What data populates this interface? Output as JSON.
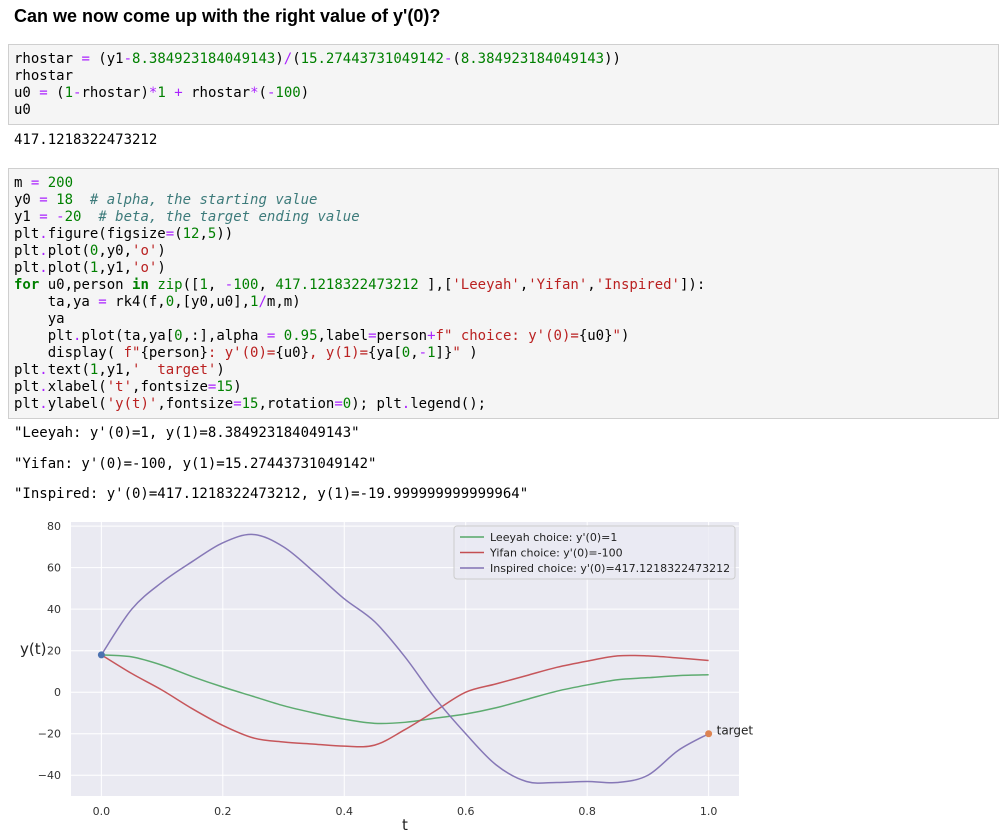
{
  "heading": "Can we now come up with the right value of y'(0)?",
  "cell1": {
    "lines": [
      [
        [
          "n",
          "rhostar "
        ],
        [
          "o",
          "="
        ],
        [
          "n",
          " (y1"
        ],
        [
          "o",
          "-"
        ],
        [
          "m",
          "8.384923184049143"
        ],
        [
          "n",
          ")"
        ],
        [
          "o",
          "/"
        ],
        [
          "n",
          "("
        ],
        [
          "m",
          "15.27443731049142"
        ],
        [
          "o",
          "-"
        ],
        [
          "n",
          "("
        ],
        [
          "m",
          "8.384923184049143"
        ],
        [
          "n",
          "))"
        ]
      ],
      [
        [
          "n",
          "rhostar"
        ]
      ],
      [
        [
          "n",
          "u0 "
        ],
        [
          "o",
          "="
        ],
        [
          "n",
          " ("
        ],
        [
          "m",
          "1"
        ],
        [
          "o",
          "-"
        ],
        [
          "n",
          "rhostar)"
        ],
        [
          "o",
          "*"
        ],
        [
          "m",
          "1"
        ],
        [
          "n",
          " "
        ],
        [
          "o",
          "+"
        ],
        [
          "n",
          " rhostar"
        ],
        [
          "o",
          "*"
        ],
        [
          "n",
          "("
        ],
        [
          "o",
          "-"
        ],
        [
          "m",
          "100"
        ],
        [
          "n",
          ")"
        ]
      ],
      [
        [
          "n",
          "u0"
        ]
      ]
    ]
  },
  "output1": "417.1218322473212",
  "cell2": {
    "lines": [
      [
        [
          "n",
          "m "
        ],
        [
          "o",
          "="
        ],
        [
          "n",
          " "
        ],
        [
          "m",
          "200"
        ]
      ],
      [
        [
          "n",
          "y0 "
        ],
        [
          "o",
          "="
        ],
        [
          "n",
          " "
        ],
        [
          "m",
          "18"
        ],
        [
          "n",
          "  "
        ],
        [
          "c",
          "# alpha, the starting value"
        ]
      ],
      [
        [
          "n",
          "y1 "
        ],
        [
          "o",
          "="
        ],
        [
          "n",
          " "
        ],
        [
          "o",
          "-"
        ],
        [
          "m",
          "20"
        ],
        [
          "n",
          "  "
        ],
        [
          "c",
          "# beta, the target ending value"
        ]
      ],
      [
        [
          "n",
          "plt"
        ],
        [
          "o",
          "."
        ],
        [
          "n",
          "figure(figsize"
        ],
        [
          "o",
          "="
        ],
        [
          "n",
          "("
        ],
        [
          "m",
          "12"
        ],
        [
          "n",
          ","
        ],
        [
          "m",
          "5"
        ],
        [
          "n",
          "))"
        ]
      ],
      [
        [
          "n",
          "plt"
        ],
        [
          "o",
          "."
        ],
        [
          "n",
          "plot("
        ],
        [
          "m",
          "0"
        ],
        [
          "n",
          ",y0,"
        ],
        [
          "s",
          "'o'"
        ],
        [
          "n",
          ")"
        ]
      ],
      [
        [
          "n",
          "plt"
        ],
        [
          "o",
          "."
        ],
        [
          "n",
          "plot("
        ],
        [
          "m",
          "1"
        ],
        [
          "n",
          ",y1,"
        ],
        [
          "s",
          "'o'"
        ],
        [
          "n",
          ")"
        ]
      ],
      [
        [
          "k",
          "for"
        ],
        [
          "n",
          " u0,person "
        ],
        [
          "k",
          "in"
        ],
        [
          "n",
          " "
        ],
        [
          "b",
          "zip"
        ],
        [
          "n",
          "(["
        ],
        [
          "m",
          "1"
        ],
        [
          "n",
          ", "
        ],
        [
          "o",
          "-"
        ],
        [
          "m",
          "100"
        ],
        [
          "n",
          ", "
        ],
        [
          "m",
          "417.1218322473212"
        ],
        [
          "n",
          " ],["
        ],
        [
          "s",
          "'Leeyah'"
        ],
        [
          "n",
          ","
        ],
        [
          "s",
          "'Yifan'"
        ],
        [
          "n",
          ","
        ],
        [
          "s",
          "'Inspired'"
        ],
        [
          "n",
          "]):"
        ]
      ],
      [
        [
          "n",
          "    ta,ya "
        ],
        [
          "o",
          "="
        ],
        [
          "n",
          " rk4(f,"
        ],
        [
          "m",
          "0"
        ],
        [
          "n",
          ",[y0,u0],"
        ],
        [
          "m",
          "1"
        ],
        [
          "o",
          "/"
        ],
        [
          "n",
          "m,m)"
        ]
      ],
      [
        [
          "n",
          "    ya"
        ]
      ],
      [
        [
          "n",
          "    plt"
        ],
        [
          "o",
          "."
        ],
        [
          "n",
          "plot(ta,ya["
        ],
        [
          "m",
          "0"
        ],
        [
          "n",
          ",:],alpha "
        ],
        [
          "o",
          "="
        ],
        [
          "n",
          " "
        ],
        [
          "m",
          "0.95"
        ],
        [
          "n",
          ",label"
        ],
        [
          "o",
          "="
        ],
        [
          "n",
          "person"
        ],
        [
          "o",
          "+"
        ],
        [
          "s",
          "f\" choice: y'(0)="
        ],
        [
          "n",
          "{u0}"
        ],
        [
          "s",
          "\""
        ],
        [
          "n",
          ")"
        ]
      ],
      [
        [
          "n",
          "    display( "
        ],
        [
          "s",
          "f\""
        ],
        [
          "n",
          "{person}"
        ],
        [
          "s",
          ": y'(0)="
        ],
        [
          "n",
          "{u0}"
        ],
        [
          "s",
          ", y(1)="
        ],
        [
          "n",
          "{ya["
        ],
        [
          "m",
          "0"
        ],
        [
          "n",
          ","
        ],
        [
          "o",
          "-"
        ],
        [
          "m",
          "1"
        ],
        [
          "n",
          "]}"
        ],
        [
          "s",
          "\""
        ],
        [
          "n",
          " )"
        ]
      ],
      [
        [
          "n",
          "plt"
        ],
        [
          "o",
          "."
        ],
        [
          "n",
          "text("
        ],
        [
          "m",
          "1"
        ],
        [
          "n",
          ",y1,"
        ],
        [
          "s",
          "'  target'"
        ],
        [
          "n",
          ")"
        ]
      ],
      [
        [
          "n",
          "plt"
        ],
        [
          "o",
          "."
        ],
        [
          "n",
          "xlabel("
        ],
        [
          "s",
          "'t'"
        ],
        [
          "n",
          ",fontsize"
        ],
        [
          "o",
          "="
        ],
        [
          "m",
          "15"
        ],
        [
          "n",
          ")"
        ]
      ],
      [
        [
          "n",
          "plt"
        ],
        [
          "o",
          "."
        ],
        [
          "n",
          "ylabel("
        ],
        [
          "s",
          "'y(t)'"
        ],
        [
          "n",
          ",fontsize"
        ],
        [
          "o",
          "="
        ],
        [
          "m",
          "15"
        ],
        [
          "n",
          ",rotation"
        ],
        [
          "o",
          "="
        ],
        [
          "m",
          "0"
        ],
        [
          "n",
          "); plt"
        ],
        [
          "o",
          "."
        ],
        [
          "n",
          "legend();"
        ]
      ]
    ]
  },
  "outputs2": [
    "\"Leeyah: y'(0)=1, y(1)=8.384923184049143\"",
    "\"Yifan: y'(0)=-100, y(1)=15.27443731049142\"",
    "\"Inspired: y'(0)=417.1218322473212, y(1)=-19.999999999999964\""
  ],
  "chart_data": {
    "type": "line",
    "xlabel": "t",
    "ylabel": "y(t)",
    "xlim": [
      -0.05,
      1.05
    ],
    "ylim": [
      -50,
      82
    ],
    "xticks": [
      "0.0",
      "0.2",
      "0.4",
      "0.6",
      "0.8",
      "1.0"
    ],
    "yticks": [
      "80",
      "60",
      "40",
      "20",
      "0",
      "−20",
      "−40"
    ],
    "grid": true,
    "legend_position": "top-right",
    "x": [
      0,
      0.05,
      0.1,
      0.15,
      0.2,
      0.25,
      0.3,
      0.35,
      0.4,
      0.45,
      0.5,
      0.55,
      0.6,
      0.65,
      0.7,
      0.75,
      0.8,
      0.85,
      0.9,
      0.95,
      1.0
    ],
    "series": [
      {
        "name": "Leeyah choice: y'(0)=1",
        "color": "#55a868",
        "values": [
          18,
          17,
          13,
          7.5,
          2.5,
          -2,
          -6.5,
          -10,
          -13,
          -15,
          -14.5,
          -12.5,
          -10.5,
          -7.5,
          -3.5,
          0.5,
          3.5,
          6,
          7,
          8,
          8.4
        ]
      },
      {
        "name": "Yifan choice: y'(0)=-100",
        "color": "#c44e52",
        "values": [
          18,
          9,
          1,
          -8,
          -16,
          -22,
          -24,
          -25,
          -26,
          -25.5,
          -18,
          -9,
          0,
          4,
          8,
          12,
          15,
          17.5,
          17.5,
          16.5,
          15.3
        ]
      },
      {
        "name": "Inspired choice: y'(0)=417.1218322473212",
        "color": "#8172b3",
        "values": [
          18,
          40,
          53,
          63,
          72,
          76,
          70,
          58,
          45,
          34,
          17,
          -3,
          -20,
          -35,
          -43,
          -43.5,
          -43,
          -43.5,
          -40,
          -28,
          -20
        ]
      }
    ],
    "points": [
      {
        "x": 0,
        "y": 18,
        "color": "#4c72b0"
      },
      {
        "x": 1,
        "y": -20,
        "color": "#dd8452"
      }
    ],
    "annotations": [
      {
        "x": 1,
        "y": -20,
        "text": "  target"
      }
    ]
  }
}
